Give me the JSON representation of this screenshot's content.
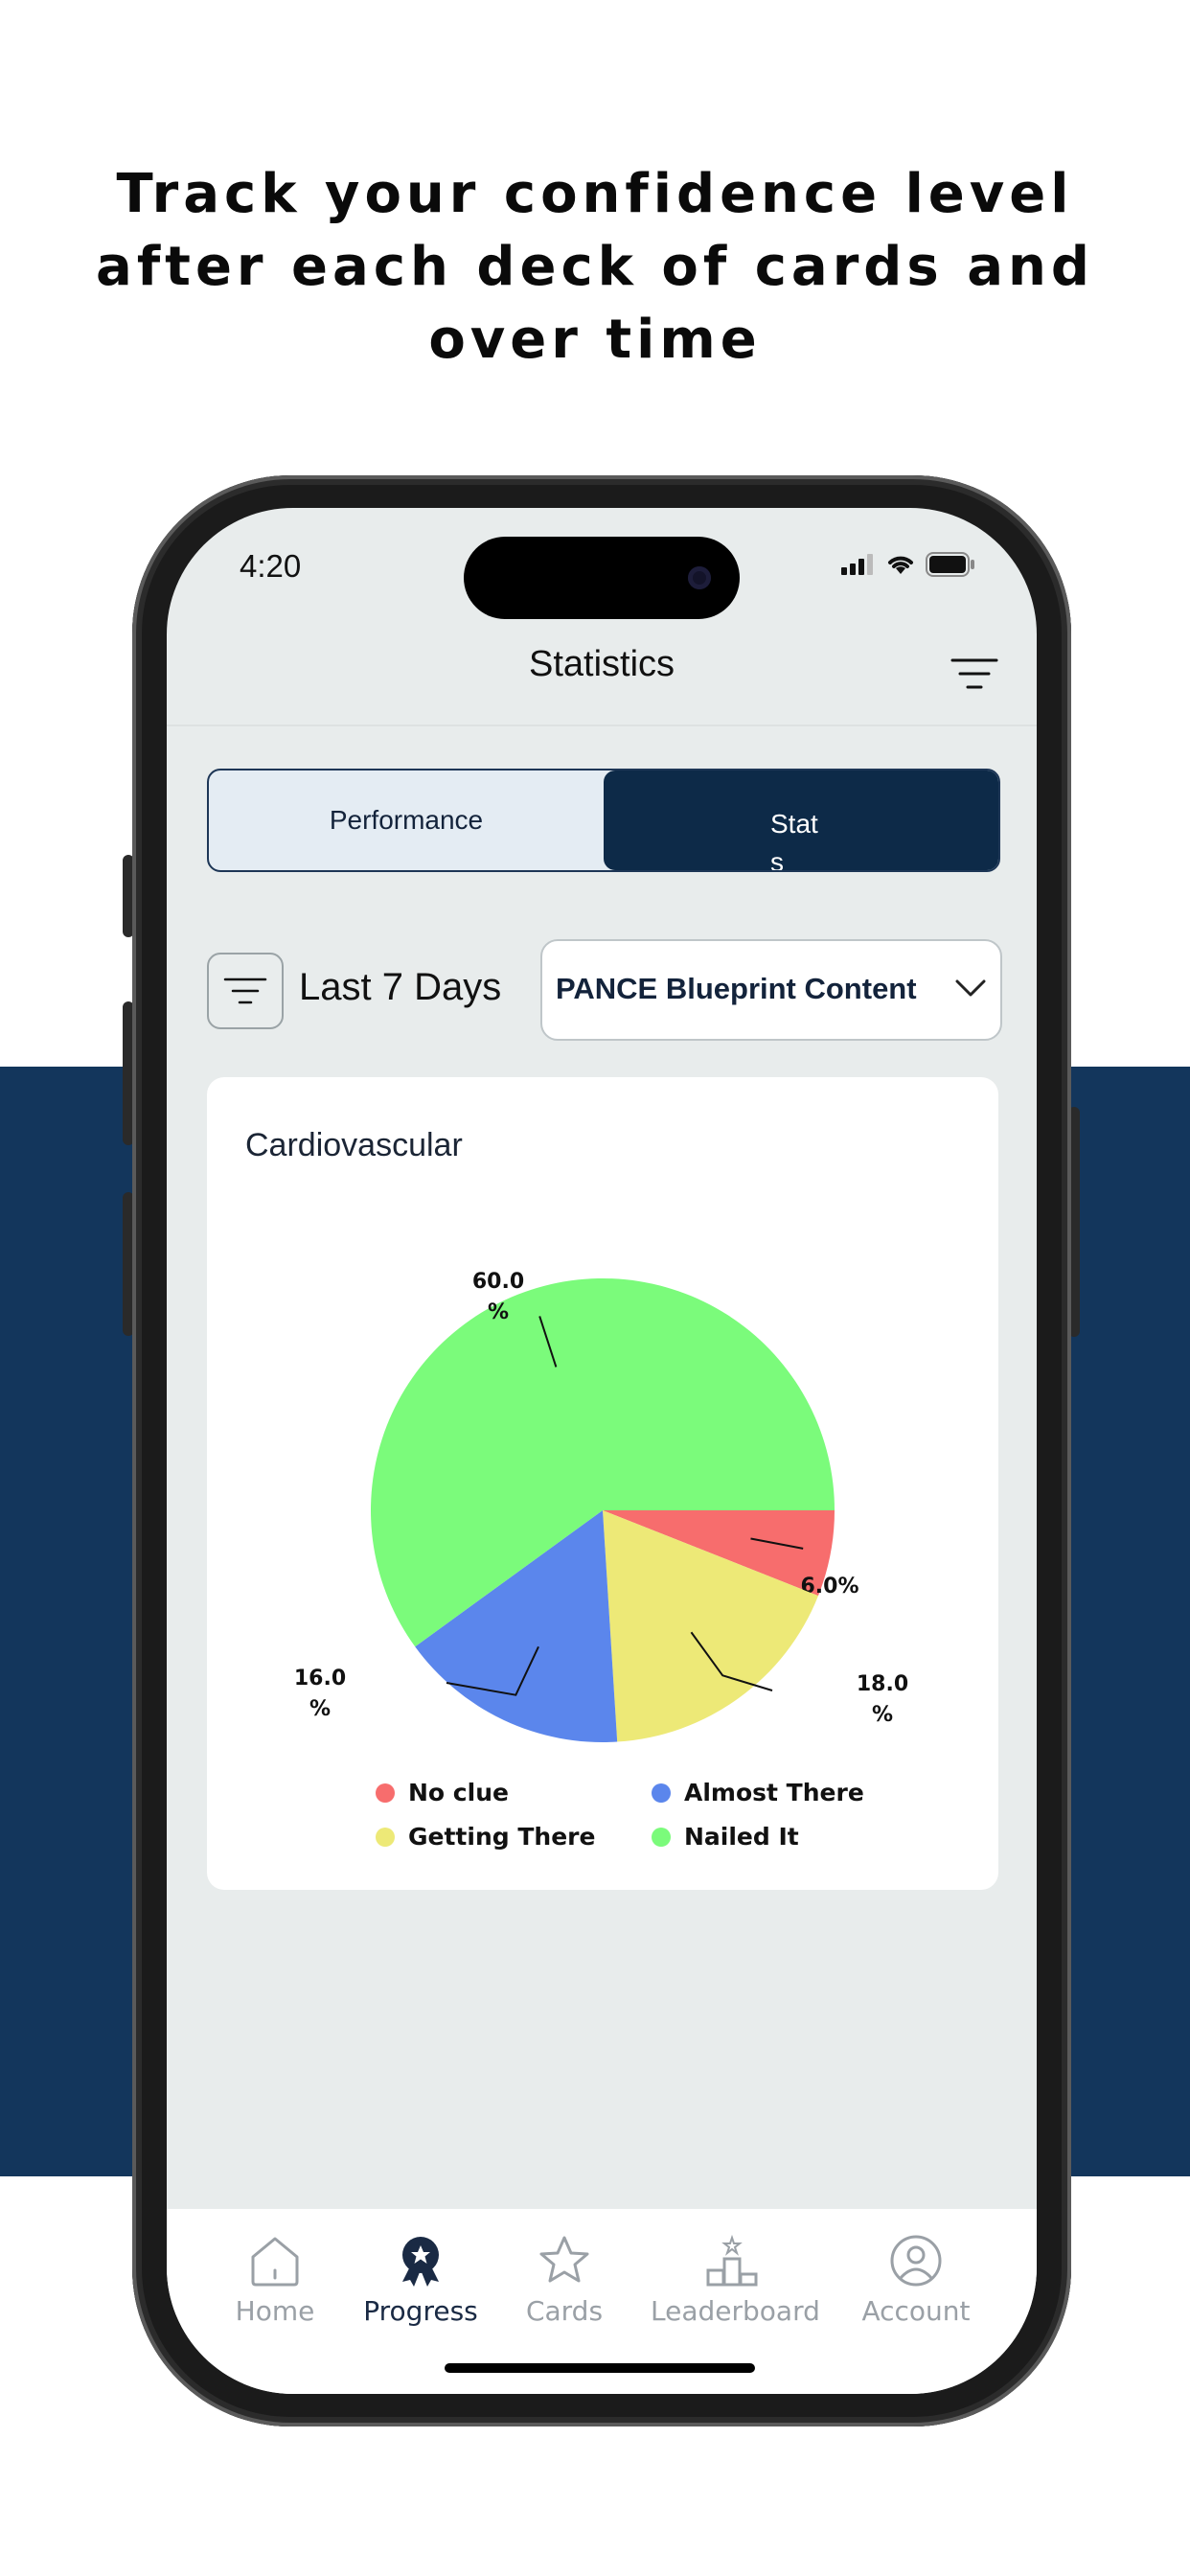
{
  "headline": {
    "line1": "Track your confidence level",
    "line2": "after each deck of cards and",
    "line3": "over time"
  },
  "status_bar": {
    "time": "4:20"
  },
  "header": {
    "title": "Statistics",
    "filter_icon": "filter-lines-icon"
  },
  "segmented": {
    "left": "Performance",
    "right": "Stats",
    "selected": "Stats"
  },
  "filters": {
    "range": "Last 7 Days",
    "category": "PANCE Blueprint Content"
  },
  "card": {
    "title": "Cardiovascular"
  },
  "chart_data": {
    "type": "pie",
    "title": "Cardiovascular",
    "slices": [
      {
        "label": "No clue",
        "value": 6.0,
        "display": "6.0%",
        "color": "#f76d6d"
      },
      {
        "label": "Getting There",
        "value": 18.0,
        "display": "18.0\n%",
        "color": "#ede977"
      },
      {
        "label": "Almost There",
        "value": 16.0,
        "display": "16.0\n%",
        "color": "#5b86ec"
      },
      {
        "label": "Nailed It",
        "value": 60.0,
        "display": "60.0\n%",
        "color": "#7bfb7b"
      }
    ],
    "legend": [
      {
        "label": "No clue",
        "color": "#f76d6d"
      },
      {
        "label": "Almost There",
        "color": "#5b86ec"
      },
      {
        "label": "Getting There",
        "color": "#ede977"
      },
      {
        "label": "Nailed It",
        "color": "#7bfb7b"
      }
    ],
    "legend_position": "bottom"
  },
  "tabbar": {
    "items": [
      {
        "label": "Home",
        "icon": "home-icon",
        "active": false
      },
      {
        "label": "Progress",
        "icon": "award-icon",
        "active": true
      },
      {
        "label": "Cards",
        "icon": "star-icon",
        "active": false
      },
      {
        "label": "Leaderboard",
        "icon": "podium-icon",
        "active": false
      },
      {
        "label": "Account",
        "icon": "user-circle-icon",
        "active": false
      }
    ]
  },
  "colors": {
    "brand_navy": "#13365c",
    "segment_active": "#0d2a48"
  }
}
